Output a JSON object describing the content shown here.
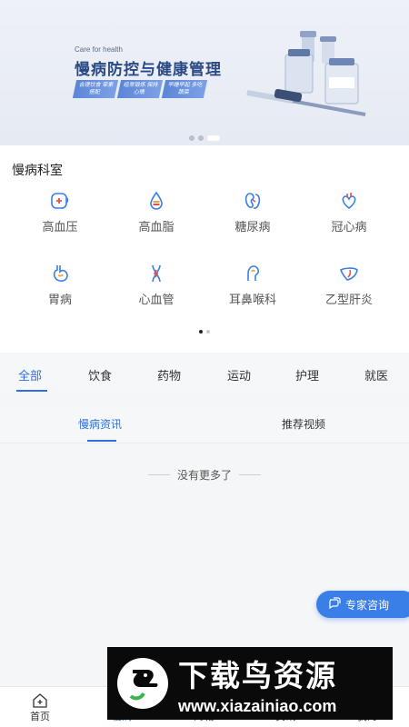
{
  "banner": {
    "subtitle": "Care for health",
    "title": "慢病防控与健康管理",
    "tags": [
      "合理饮食 荤素搭配",
      "经常锻炼 保持心情",
      "早睡早起 多吃蔬菜"
    ],
    "carousel_index": 3,
    "carousel_count": 3
  },
  "clinics": {
    "title": "慢病科室",
    "items": [
      {
        "label": "高血压",
        "icon": "blood-pressure-icon"
      },
      {
        "label": "高血脂",
        "icon": "blood-lipid-icon"
      },
      {
        "label": "糖尿病",
        "icon": "kidney-icon"
      },
      {
        "label": "冠心病",
        "icon": "heart-icon"
      },
      {
        "label": "胃病",
        "icon": "stomach-icon"
      },
      {
        "label": "心血管",
        "icon": "blood-vessel-icon"
      },
      {
        "label": "耳鼻喉科",
        "icon": "ear-nose-throat-icon"
      },
      {
        "label": "乙型肝炎",
        "icon": "liver-icon"
      }
    ],
    "page_index": 1,
    "page_count": 2
  },
  "categories": {
    "items": [
      "全部",
      "饮食",
      "药物",
      "运动",
      "护理",
      "就医"
    ],
    "selected": "全部"
  },
  "subtabs": {
    "items": [
      "慢病资讯",
      "推荐视频"
    ],
    "selected": "慢病资讯"
  },
  "list": {
    "end_text": "没有更多了"
  },
  "consult_button": {
    "label": "专家咨询"
  },
  "bottom_nav": {
    "items": [
      "首页",
      "慢病",
      "商城",
      "资讯",
      "我的"
    ],
    "selected": "慢病"
  },
  "watermark": {
    "text": "下载鸟资源",
    "url": "www.xiazainiao.com"
  },
  "colors": {
    "accent": "#2f6fe0",
    "consult_bg": "#3a7ee8",
    "icon_red": "#e2504c",
    "icon_orange": "#f0a040"
  }
}
